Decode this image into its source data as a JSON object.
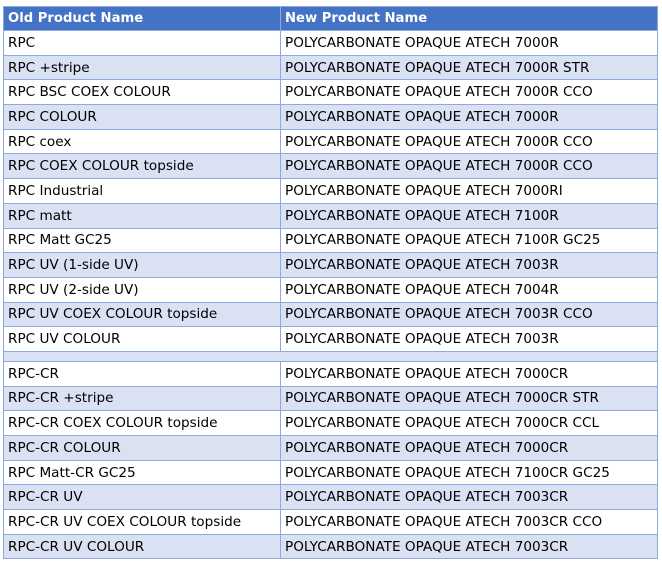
{
  "table": {
    "headers": [
      "Old Product Name",
      "New Product Name"
    ],
    "rows_group1": [
      [
        "RPC",
        "POLYCARBONATE OPAQUE ATECH 7000R"
      ],
      [
        "RPC +stripe",
        "POLYCARBONATE OPAQUE ATECH 7000R STR"
      ],
      [
        "RPC BSC COEX COLOUR",
        "POLYCARBONATE OPAQUE ATECH 7000R CCO"
      ],
      [
        "RPC COLOUR",
        "POLYCARBONATE OPAQUE ATECH 7000R"
      ],
      [
        "RPC coex",
        "POLYCARBONATE OPAQUE ATECH 7000R CCO"
      ],
      [
        "RPC COEX COLOUR topside",
        "POLYCARBONATE OPAQUE ATECH 7000R CCO"
      ],
      [
        "RPC Industrial",
        "POLYCARBONATE OPAQUE ATECH 7000RI"
      ],
      [
        "RPC matt",
        "POLYCARBONATE OPAQUE ATECH 7100R"
      ],
      [
        "RPC Matt GC25",
        "POLYCARBONATE OPAQUE ATECH 7100R GC25"
      ],
      [
        "RPC UV (1-side UV)",
        "POLYCARBONATE OPAQUE ATECH 7003R"
      ],
      [
        "RPC UV (2-side UV)",
        "POLYCARBONATE OPAQUE ATECH 7004R"
      ],
      [
        "RPC UV COEX COLOUR topside",
        "POLYCARBONATE OPAQUE ATECH 7003R CCO"
      ],
      [
        "RPC UV COLOUR",
        "POLYCARBONATE OPAQUE ATECH 7003R"
      ]
    ],
    "rows_group2": [
      [
        "RPC-CR",
        "POLYCARBONATE OPAQUE ATECH 7000CR"
      ],
      [
        "RPC-CR +stripe",
        "POLYCARBONATE OPAQUE ATECH 7000CR STR"
      ],
      [
        "RPC-CR COEX COLOUR topside",
        "POLYCARBONATE OPAQUE ATECH 7000CR CCL"
      ],
      [
        "RPC-CR COLOUR",
        "POLYCARBONATE OPAQUE ATECH 7000CR"
      ],
      [
        "RPC Matt-CR GC25",
        "POLYCARBONATE OPAQUE ATECH 7100CR GC25"
      ],
      [
        "RPC-CR UV",
        "POLYCARBONATE OPAQUE ATECH 7003CR"
      ],
      [
        "RPC-CR UV COEX COLOUR topside",
        "POLYCARBONATE OPAQUE ATECH 7003CR CCO"
      ],
      [
        "RPC-CR UV COLOUR",
        "POLYCARBONATE OPAQUE ATECH 7003CR"
      ]
    ]
  },
  "colors": {
    "header_bg": "#4472C4",
    "band_bg": "#D9E1F2",
    "border": "#8EA9DB"
  }
}
